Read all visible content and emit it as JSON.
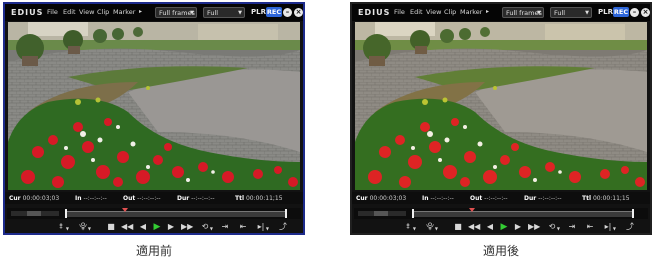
{
  "before": {
    "app_name": "EDIUS",
    "menu": [
      "File",
      "Edit",
      "View",
      "Clip",
      "Marker"
    ],
    "menu_more": "▸",
    "frames_select": "Full frames",
    "quality_select": "Full",
    "plr": "PLR",
    "rec": "REC",
    "minimize": "–",
    "close": "×",
    "timecodes": {
      "cur_label": "Cur",
      "cur_value": "00:00:03;03",
      "in_label": "In",
      "in_value": "--:--:--:--",
      "out_label": "Out",
      "out_value": "--:--:--:--",
      "dur_label": "Dur",
      "dur_value": "--:--:--:--",
      "ttl_label": "Ttl",
      "ttl_value": "00:00:11;15"
    },
    "caption": "適用前"
  },
  "after": {
    "app_name": "EDIUS",
    "menu": [
      "File",
      "Edit",
      "View",
      "Clip",
      "Marker"
    ],
    "menu_more": "▸",
    "frames_select": "Full frames",
    "quality_select": "Full",
    "plr": "PLR",
    "rec": "REC",
    "minimize": "–",
    "close": "×",
    "timecodes": {
      "cur_label": "Cur",
      "cur_value": "00:00:03;03",
      "in_label": "In",
      "in_value": "--:--:--:--",
      "out_label": "Out",
      "out_value": "--:--:--:--",
      "dur_label": "Dur",
      "dur_value": "--:--:--:--",
      "ttl_label": "Ttl",
      "ttl_value": "00:00:11;15"
    },
    "caption": "適用後"
  },
  "icons": {
    "set_in": "⯒",
    "set_out": "⯓",
    "stop": "■",
    "rewind": "◀◀",
    "step_back": "◀",
    "play": "▶",
    "step_forward": "▶",
    "fast_forward": "▶▶",
    "loop": "⟲",
    "insert": "⇥",
    "overwrite": "⇤",
    "replace": "▸|",
    "export": "⤴",
    "dropdown": "▼"
  },
  "colors": {
    "rec_badge": "#2e66d9",
    "play_green": "#33cc33",
    "frame_border_before": "#1d2b8c",
    "frame_border_after": "#202020"
  }
}
